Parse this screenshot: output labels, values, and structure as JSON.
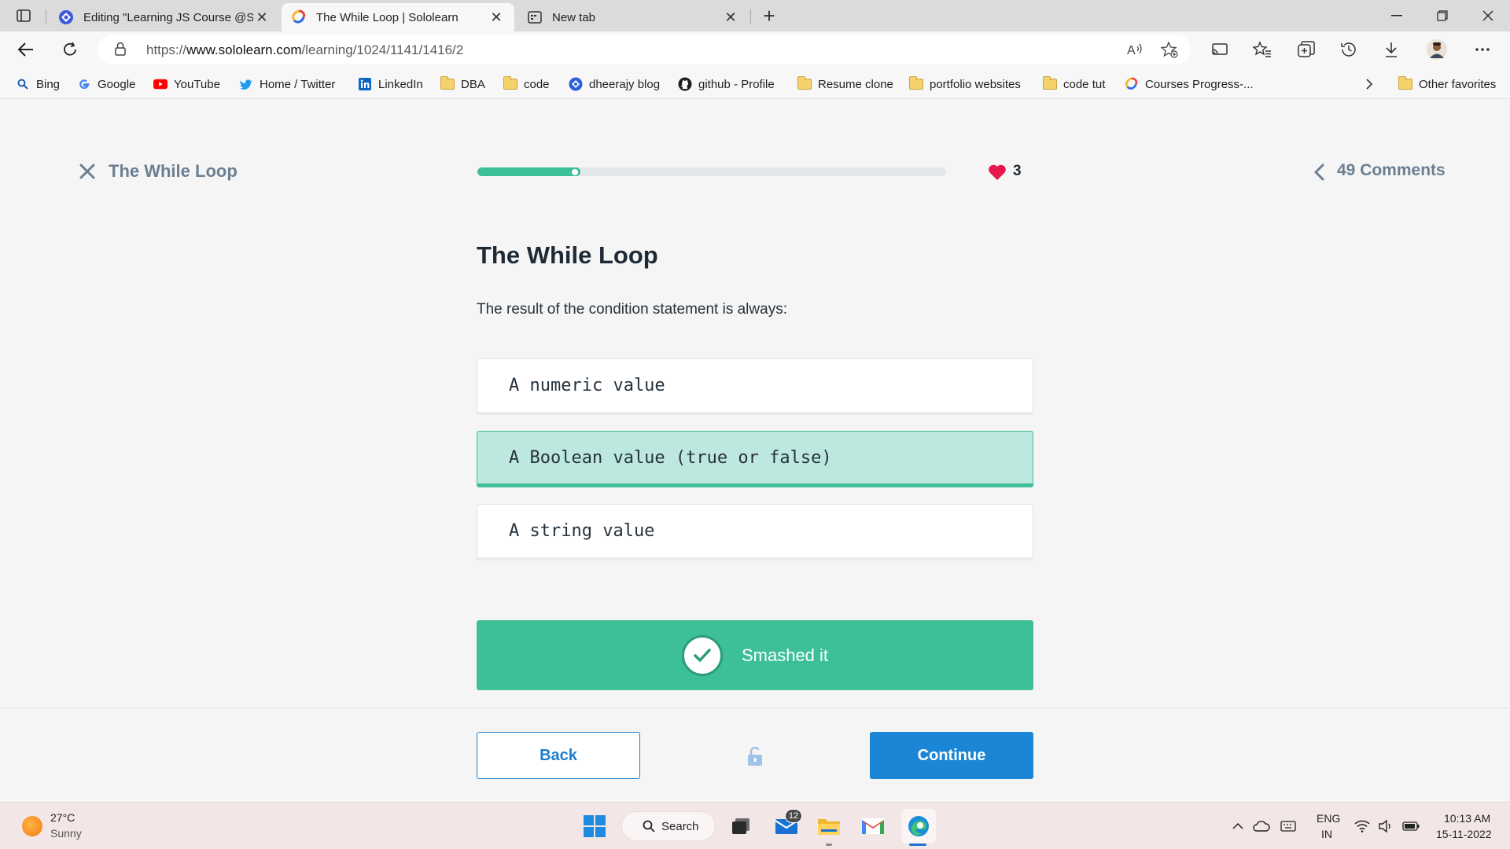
{
  "browser": {
    "tabs": [
      {
        "title": "Editing \"Learning JS Course @Sololearn\"",
        "icon": "editor-icon"
      },
      {
        "title": "The While Loop | Sololearn",
        "icon": "sololearn-icon"
      },
      {
        "title": "New tab",
        "icon": "newtab-icon"
      }
    ],
    "url_prefix": "https://",
    "url_domain": "www.sololearn.com",
    "url_path": "/learning/1024/1141/1416/2",
    "bookmarks": [
      {
        "label": "Bing"
      },
      {
        "label": "Google"
      },
      {
        "label": "YouTube"
      },
      {
        "label": "Home / Twitter"
      },
      {
        "label": "LinkedIn"
      },
      {
        "label": "DBA"
      },
      {
        "label": "code"
      },
      {
        "label": "dheerajy blog"
      },
      {
        "label": "github - Profile"
      },
      {
        "label": "Resume clone"
      },
      {
        "label": "portfolio websites"
      },
      {
        "label": "code tut"
      },
      {
        "label": "Courses Progress-..."
      },
      {
        "label": "Other favorites"
      }
    ]
  },
  "lesson": {
    "header_title": "The While Loop",
    "progress": 0.22,
    "lives": "3",
    "comments": "49 Comments",
    "title": "The While Loop",
    "question": "The result of the condition statement is always:",
    "options": [
      {
        "text": "A numeric value",
        "state": "default"
      },
      {
        "text": "A Boolean value (true or false)",
        "state": "correct"
      },
      {
        "text": "A string value",
        "state": "default"
      }
    ],
    "result_text": "Smashed it",
    "back_label": "Back",
    "continue_label": "Continue"
  },
  "colors": {
    "accent_green": "#3dbf97",
    "correct_bg": "#bde8df",
    "continue_blue": "#1c86d6",
    "heart_red": "#e8174c"
  },
  "taskbar": {
    "temperature": "27°C",
    "condition": "Sunny",
    "search_label": "Search",
    "mail_badge": "12",
    "lang_top": "ENG",
    "lang_bottom": "IN",
    "time": "10:13 AM",
    "date": "15-11-2022"
  }
}
